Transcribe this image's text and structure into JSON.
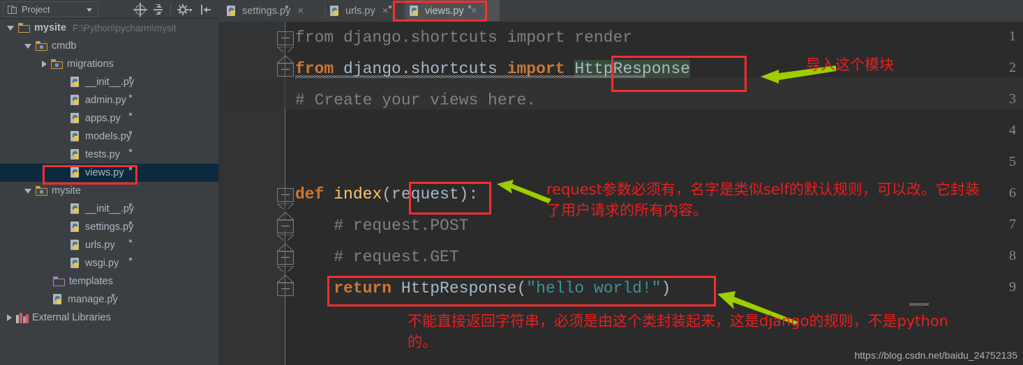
{
  "sidebar": {
    "combo_label": "Project",
    "combo_icon": "project-view-icon",
    "toolbar_icons": [
      "locate-target-icon",
      "collapse-all-icon",
      "settings-gear-icon",
      "hide-panel-icon"
    ],
    "tree": [
      {
        "label": "mysite",
        "path": "F:\\Python\\pycharm\\mysit",
        "icon": "folder-icon",
        "arrow": "down",
        "indent": 0,
        "bold": true,
        "selected": false
      },
      {
        "label": "cmdb",
        "path": "",
        "icon": "source-folder-icon",
        "arrow": "down",
        "indent": 1,
        "bold": false,
        "selected": false
      },
      {
        "label": "migrations",
        "path": "",
        "icon": "source-folder-icon",
        "arrow": "right",
        "indent": 2,
        "bold": false,
        "selected": false
      },
      {
        "label": "__init__.py",
        "path": "",
        "icon": "python-file-icon",
        "arrow": "none",
        "indent": 3,
        "bold": false,
        "selected": false
      },
      {
        "label": "admin.py",
        "path": "",
        "icon": "python-file-icon",
        "arrow": "none",
        "indent": 3,
        "bold": false,
        "selected": false
      },
      {
        "label": "apps.py",
        "path": "",
        "icon": "python-file-icon",
        "arrow": "none",
        "indent": 3,
        "bold": false,
        "selected": false
      },
      {
        "label": "models.py",
        "path": "",
        "icon": "python-file-icon",
        "arrow": "none",
        "indent": 3,
        "bold": false,
        "selected": false
      },
      {
        "label": "tests.py",
        "path": "",
        "icon": "python-file-icon",
        "arrow": "none",
        "indent": 3,
        "bold": false,
        "selected": false
      },
      {
        "label": "views.py",
        "path": "",
        "icon": "python-file-icon",
        "arrow": "none",
        "indent": 3,
        "bold": false,
        "selected": true
      },
      {
        "label": "mysite",
        "path": "",
        "icon": "source-folder-icon",
        "arrow": "down",
        "indent": 1,
        "bold": false,
        "selected": false
      },
      {
        "label": "__init__.py",
        "path": "",
        "icon": "python-file-icon",
        "arrow": "none",
        "indent": 3,
        "bold": false,
        "selected": false
      },
      {
        "label": "settings.py",
        "path": "",
        "icon": "python-file-icon",
        "arrow": "none",
        "indent": 3,
        "bold": false,
        "selected": false
      },
      {
        "label": "urls.py",
        "path": "",
        "icon": "python-file-icon",
        "arrow": "none",
        "indent": 3,
        "bold": false,
        "selected": false
      },
      {
        "label": "wsgi.py",
        "path": "",
        "icon": "python-file-icon",
        "arrow": "none",
        "indent": 3,
        "bold": false,
        "selected": false
      },
      {
        "label": "templates",
        "path": "",
        "icon": "templates-folder-icon",
        "arrow": "none",
        "indent": 2,
        "bold": false,
        "selected": false
      },
      {
        "label": "manage.py",
        "path": "",
        "icon": "python-file-icon",
        "arrow": "none",
        "indent": 2,
        "bold": false,
        "selected": false
      },
      {
        "label": "External Libraries",
        "path": "",
        "icon": "libraries-icon",
        "arrow": "right",
        "indent": 0,
        "bold": false,
        "selected": false
      }
    ]
  },
  "editor": {
    "tabs": [
      {
        "label": "settings.py",
        "active": false,
        "close": "×"
      },
      {
        "label": "urls.py",
        "active": false,
        "close": "×"
      },
      {
        "label": "views.py",
        "active": true,
        "close": "×"
      }
    ],
    "line_numbers": [
      "1",
      "2",
      "3",
      "4",
      "5",
      "6",
      "7",
      "8",
      "9"
    ],
    "lines": [
      {
        "n": 1,
        "tokens": [
          {
            "t": "from django.shortcuts import render",
            "c": "c-grey"
          }
        ]
      },
      {
        "n": 2,
        "tokens": [
          {
            "t": "from",
            "c": "c-kw"
          },
          {
            "t": " django.shortcuts ",
            "c": "c-plain"
          },
          {
            "t": "import",
            "c": "c-kw"
          },
          {
            "t": " ",
            "c": "c-plain"
          },
          {
            "t": "HttpResponse",
            "c": "c-plain hl-green"
          }
        ]
      },
      {
        "n": 3,
        "tokens": [
          {
            "t": "# Create your views here.",
            "c": "c-cmt"
          }
        ]
      },
      {
        "n": 4,
        "tokens": []
      },
      {
        "n": 5,
        "tokens": []
      },
      {
        "n": 6,
        "tokens": [
          {
            "t": "def",
            "c": "c-kw"
          },
          {
            "t": " ",
            "c": "c-plain"
          },
          {
            "t": "index",
            "c": "c-fn"
          },
          {
            "t": "(request):",
            "c": "c-plain"
          }
        ]
      },
      {
        "n": 7,
        "tokens": [
          {
            "t": "    # request.POST",
            "c": "c-cmt"
          }
        ]
      },
      {
        "n": 8,
        "tokens": [
          {
            "t": "    # request.GET",
            "c": "c-cmt"
          }
        ]
      },
      {
        "n": 9,
        "tokens": [
          {
            "t": "    ",
            "c": "c-plain"
          },
          {
            "t": "return",
            "c": "c-kw"
          },
          {
            "t": " HttpResponse(",
            "c": "c-plain"
          },
          {
            "t": "\"hello world!\"",
            "c": "c-str2"
          },
          {
            "t": ")",
            "c": "c-plain"
          }
        ]
      }
    ]
  },
  "annotations": {
    "note_import": "导入这个模块",
    "note_request": "request参数必须有，名字是类似self的默认规则，可以改。它封装\n了用户请求的所有内容。",
    "note_return": "不能直接返回字符串，必须是由这个类封装起来，这是django的规则，不是python\n的。",
    "watermark": "https://blog.csdn.net/baidu_24752135",
    "highlight_color": "#ff2d2d",
    "arrow_color": "#9ecd00",
    "text_color": "#e62020"
  },
  "theme": {
    "editor_bg": "#2b2b2b",
    "panel_bg": "#3c3f41",
    "gutter_bg": "#313335",
    "selection_bg": "#0d293e",
    "keyword": "#cc7832",
    "plain_text": "#a9b7c6",
    "comment": "#808080",
    "function_name": "#ffc66d",
    "string": "#3d9396"
  }
}
